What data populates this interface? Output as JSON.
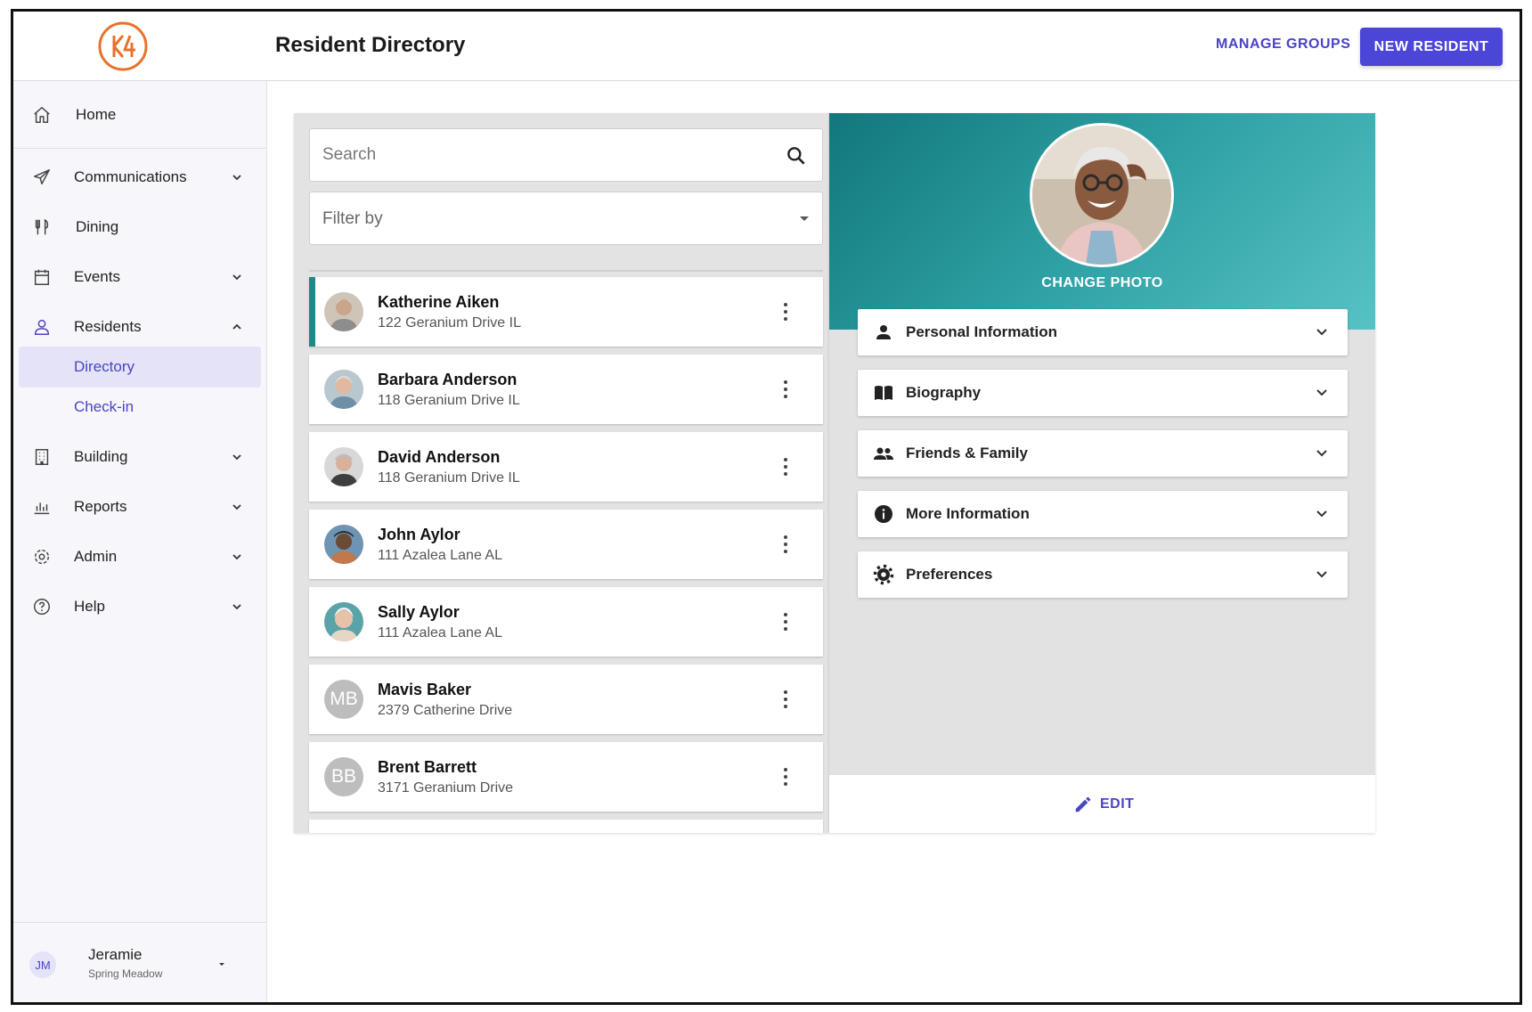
{
  "header": {
    "page_title": "Resident Directory",
    "manage_groups_label": "MANAGE GROUPS",
    "new_resident_label": "NEW RESIDENT",
    "accent_color": "#4b45d8",
    "logo_color": "#e8722c"
  },
  "sidebar": {
    "home": "Home",
    "communications": "Communications",
    "dining": "Dining",
    "events": "Events",
    "residents": "Residents",
    "directory": "Directory",
    "checkin": "Check-in",
    "building": "Building",
    "reports": "Reports",
    "admin": "Admin",
    "help": "Help"
  },
  "user": {
    "initials": "JM",
    "name": "Jeramie",
    "community": "Spring Meadow"
  },
  "search": {
    "placeholder": "Search",
    "filter_placeholder": "Filter by"
  },
  "residents": [
    {
      "name": "Katherine Aiken",
      "address": "122 Geranium Drive IL",
      "avatar": "photo",
      "selected": true
    },
    {
      "name": "Barbara Anderson",
      "address": "118 Geranium Drive IL",
      "avatar": "photo"
    },
    {
      "name": "David Anderson",
      "address": "118 Geranium Drive IL",
      "avatar": "photo"
    },
    {
      "name": "John Aylor",
      "address": "111 Azalea Lane AL",
      "avatar": "photo"
    },
    {
      "name": "Sally Aylor",
      "address": "111 Azalea Lane AL",
      "avatar": "photo"
    },
    {
      "name": "Mavis Baker",
      "address": "2379 Catherine Drive",
      "avatar": "initials",
      "initials": "MB"
    },
    {
      "name": "Brent Barrett",
      "address": "3171 Geranium Drive",
      "avatar": "initials",
      "initials": "BB"
    }
  ],
  "detail": {
    "change_photo": "CHANGE PHOTO",
    "sections": [
      {
        "label": "Personal Information",
        "icon": "person-icon"
      },
      {
        "label": "Biography",
        "icon": "book-icon"
      },
      {
        "label": "Friends & Family",
        "icon": "people-icon"
      },
      {
        "label": "More Information",
        "icon": "info-icon"
      },
      {
        "label": "Preferences",
        "icon": "gear-icon"
      }
    ],
    "edit_label": "EDIT",
    "hero_colors": [
      "#12777c",
      "#58c2c6"
    ]
  }
}
